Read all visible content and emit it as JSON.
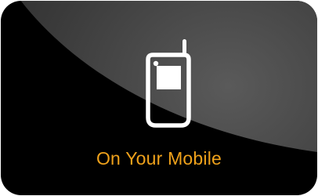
{
  "tile": {
    "label": "On Your Mobile",
    "icon": "mobile-phone-icon",
    "accent_color": "#f0a21b",
    "background_color": "#000000"
  }
}
